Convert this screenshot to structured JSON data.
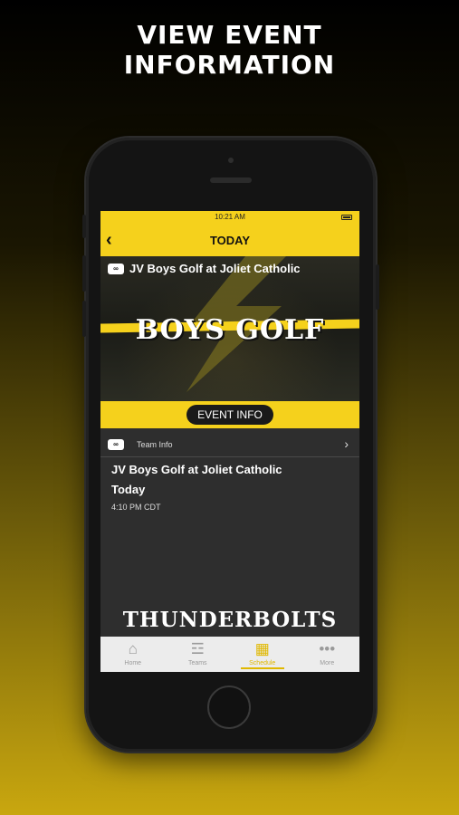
{
  "headline": {
    "line1": "VIEW EVENT",
    "line2": "INFORMATION"
  },
  "status": {
    "time": "10:21 AM"
  },
  "nav": {
    "title": "TODAY"
  },
  "banner": {
    "event_name": "JV Boys Golf at Joliet Catholic",
    "sport": "BOYS GOLF"
  },
  "event_info_label": "EVENT INFO",
  "team_info": {
    "label": "Team Info"
  },
  "event": {
    "title": "JV Boys Golf at Joliet Catholic",
    "day": "Today",
    "time": "4:10 PM CDT"
  },
  "brand_word": "THUNDERBOLTS",
  "tabs": [
    {
      "label": "Home",
      "icon": "home-icon"
    },
    {
      "label": "Teams",
      "icon": "teams-icon"
    },
    {
      "label": "Schedule",
      "icon": "calendar-icon",
      "active": true
    },
    {
      "label": "More",
      "icon": "more-icon"
    }
  ],
  "colors": {
    "accent": "#f5d11c",
    "dark": "#2e2e2e"
  }
}
